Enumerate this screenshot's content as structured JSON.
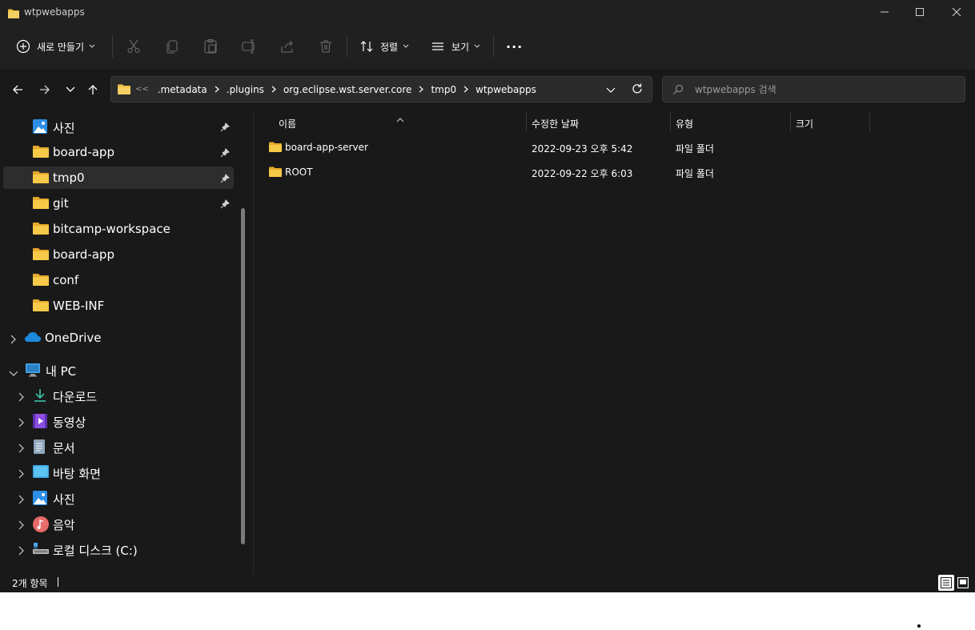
{
  "window": {
    "title": "wtpwebapps"
  },
  "commandbar": {
    "new_label": "새로 만들기",
    "sort_label": "정렬",
    "view_label": "보기",
    "more_label": "···"
  },
  "address": {
    "overflow": "<<",
    "crumbs": [
      ".metadata",
      ".plugins",
      "org.eclipse.wst.server.core",
      "tmp0",
      "wtpwebapps"
    ]
  },
  "search": {
    "placeholder": "wtpwebapps 검색"
  },
  "sidebar": {
    "quick_access": [
      {
        "label": "사진",
        "icon": "pictures-icon",
        "pinned": true
      },
      {
        "label": "board-app",
        "icon": "folder-icon",
        "pinned": true
      },
      {
        "label": "tmp0",
        "icon": "folder-icon",
        "pinned": true,
        "selected": true
      },
      {
        "label": "git",
        "icon": "folder-icon",
        "pinned": true
      },
      {
        "label": "bitcamp-workspace",
        "icon": "folder-icon",
        "pinned": false
      },
      {
        "label": "board-app",
        "icon": "folder-icon",
        "pinned": false
      },
      {
        "label": "conf",
        "icon": "folder-icon",
        "pinned": false
      },
      {
        "label": "WEB-INF",
        "icon": "folder-icon",
        "pinned": false
      }
    ],
    "onedrive": {
      "label": "OneDrive",
      "icon": "cloud-icon"
    },
    "this_pc": {
      "label": "내 PC",
      "icon": "computer-icon"
    },
    "pc_items": [
      {
        "label": "다운로드",
        "icon": "download-icon"
      },
      {
        "label": "동영상",
        "icon": "video-icon"
      },
      {
        "label": "문서",
        "icon": "document-icon"
      },
      {
        "label": "바탕 화면",
        "icon": "desktop-icon"
      },
      {
        "label": "사진",
        "icon": "pictures-icon"
      },
      {
        "label": "음악",
        "icon": "music-icon"
      },
      {
        "label": "로컬 디스크 (C:)",
        "icon": "drive-icon"
      }
    ]
  },
  "filelist": {
    "columns": {
      "name": "이름",
      "date": "수정한 날짜",
      "type": "유형",
      "size": "크기"
    },
    "rows": [
      {
        "name": "board-app-server",
        "date": "2022-09-23 오후 5:42",
        "type": "파일 폴더",
        "size": ""
      },
      {
        "name": "ROOT",
        "date": "2022-09-22 오후 6:03",
        "type": "파일 폴더",
        "size": ""
      }
    ]
  },
  "status": {
    "count": "2개 항목"
  },
  "colors": {
    "background": "#191919",
    "chrome": "#202020",
    "folder": "#f0c243",
    "selected": "#2d2d2d"
  }
}
